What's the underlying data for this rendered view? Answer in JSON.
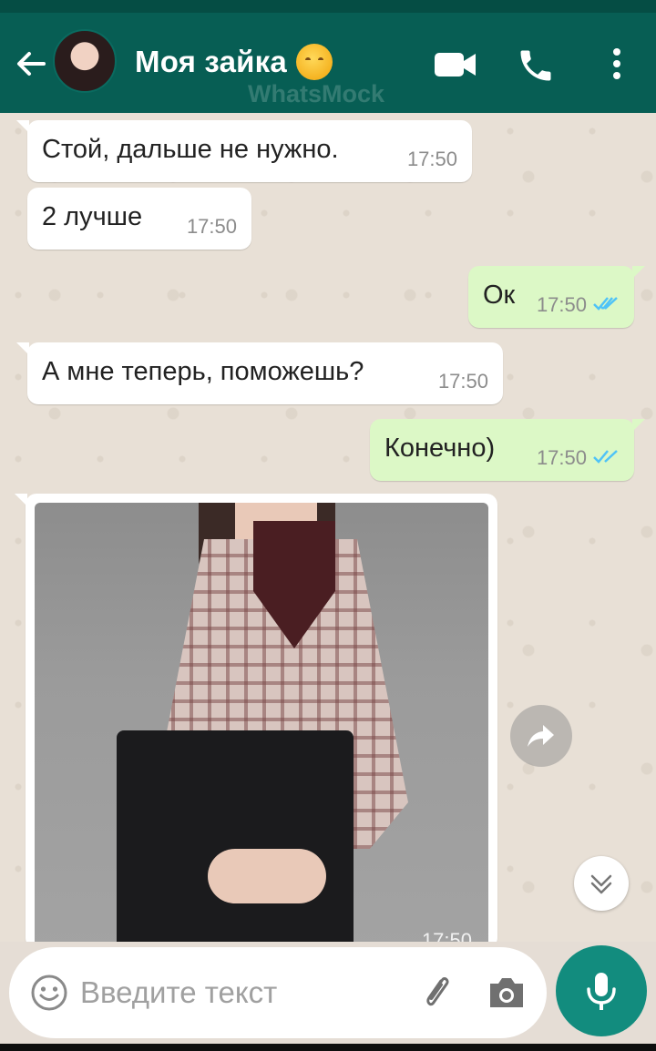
{
  "header": {
    "contact_name": "Моя зайка",
    "watermark": "WhatsMock"
  },
  "messages": [
    {
      "direction": "incoming",
      "text": "Стой, дальше не нужно.",
      "time": "17:50"
    },
    {
      "direction": "incoming",
      "text": "2 лучше",
      "time": "17:50"
    },
    {
      "direction": "outgoing",
      "text": "Ок",
      "time": "17:50",
      "status": "read"
    },
    {
      "direction": "incoming",
      "text": "А мне теперь, поможешь?",
      "time": "17:50"
    },
    {
      "direction": "outgoing",
      "text": "Конечно)",
      "time": "17:50",
      "status": "read"
    },
    {
      "direction": "incoming",
      "type": "image",
      "time": "17:50"
    }
  ],
  "composer": {
    "placeholder": "Введите текст"
  },
  "icons": {
    "back": "arrow-left-icon",
    "video": "video-call-icon",
    "call": "phone-icon",
    "menu": "more-vert-icon",
    "forward": "forward-icon",
    "scroll_down": "chevron-double-down-icon",
    "emoji": "emoji-icon",
    "attach": "paperclip-icon",
    "camera": "camera-icon",
    "mic": "microphone-icon"
  },
  "colors": {
    "header": "#075e54",
    "outgoing_bubble": "#dcf8c6",
    "incoming_bubble": "#ffffff",
    "read_ticks": "#4fc3f7",
    "mic_button": "#128c7e"
  }
}
